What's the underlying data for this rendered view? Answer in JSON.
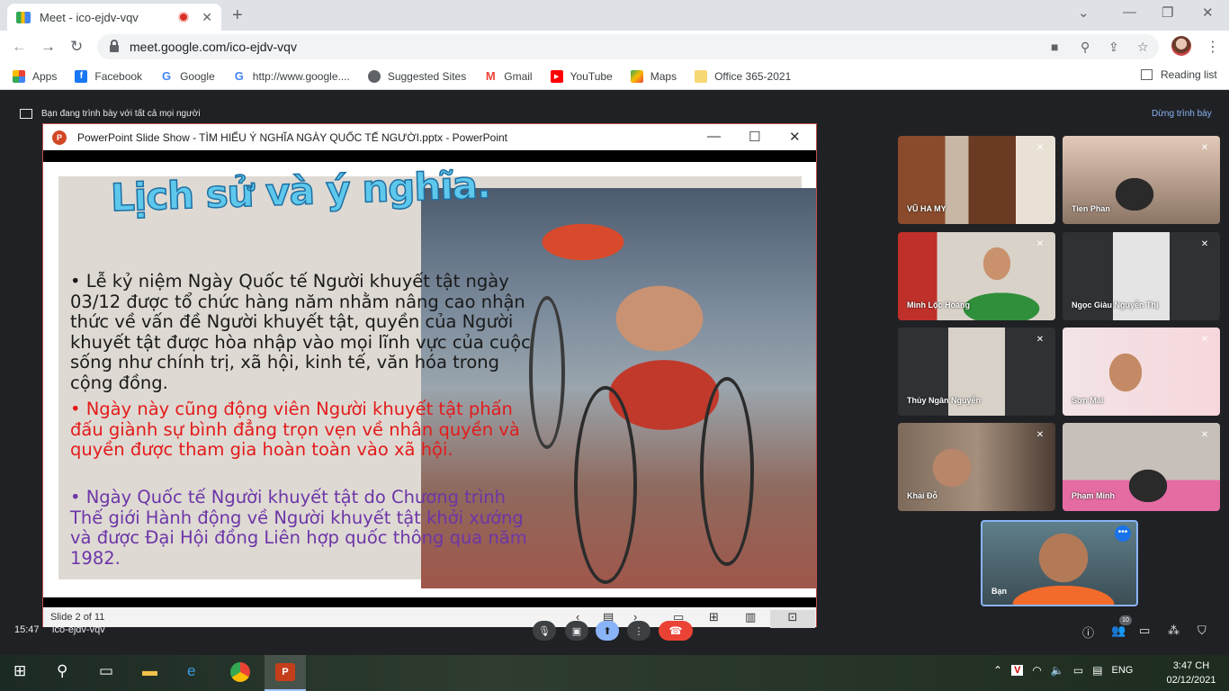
{
  "browser": {
    "tab_title": "Meet - ico-ejdv-vqv",
    "url": "meet.google.com/ico-ejdv-vqv",
    "bookmarks": [
      "Apps",
      "Facebook",
      "Google",
      "http://www.google....",
      "Suggested Sites",
      "Gmail",
      "YouTube",
      "Maps",
      "Office 365-2021"
    ],
    "reading_list": "Reading list"
  },
  "meet": {
    "presenting_text": "Bạn đang trình bày với tất cả mọi người",
    "stop_presenting": "Dừng trình bày",
    "time": "15:47",
    "meeting_code": "ico-ejdv-vqv",
    "people_count": "10",
    "participants": [
      {
        "name": "VŨ HA MY"
      },
      {
        "name": "Tien Phan"
      },
      {
        "name": "Minh Lộc Hoàng"
      },
      {
        "name": "Ngọc Giàu Nguyễn Thị"
      },
      {
        "name": "Thủy Ngân Nguyễn"
      },
      {
        "name": "Sơn Mai"
      },
      {
        "name": "Khải Đỗ"
      },
      {
        "name": "Phạm Minh"
      }
    ],
    "self_name": "Bạn"
  },
  "ppt": {
    "window_title": "PowerPoint Slide Show  -  TÌM HIỂU Ý NGHĨA NGÀY QUỐC TẾ NGƯỜI.pptx - PowerPoint",
    "status": "Slide 2 of 11",
    "slide": {
      "title": "Lịch sử và ý nghĩa.",
      "bullet1": "• Lễ kỷ niệm Ngày Quốc tế Người khuyết tật ngày 03/12 được tổ chức hàng năm nhằm nâng cao nhận thức về vấn đề Người khuyết tật, quyền của Người khuyết tật được hòa nhập vào mọi lĩnh vực của cuộc sống như chính trị, xã hội, kinh tế, văn hóa trong cộng đồng.",
      "bullet2": "•  Ngày này cũng động viên Người khuyết tật phấn đấu giành sự bình đẳng trọn vẹn về nhân quyền và quyền được tham gia hoàn toàn vào xã hội.",
      "bullet3": "• Ngày Quốc tế Người khuyết tật do Chương trình Thế giới Hành động về Người khuyết tật khởi xướng và được Đại Hội đồng Liên hợp quốc thông qua năm 1982."
    }
  },
  "taskbar": {
    "language": "ENG",
    "time": "3:47 CH",
    "date": "02/12/2021"
  }
}
